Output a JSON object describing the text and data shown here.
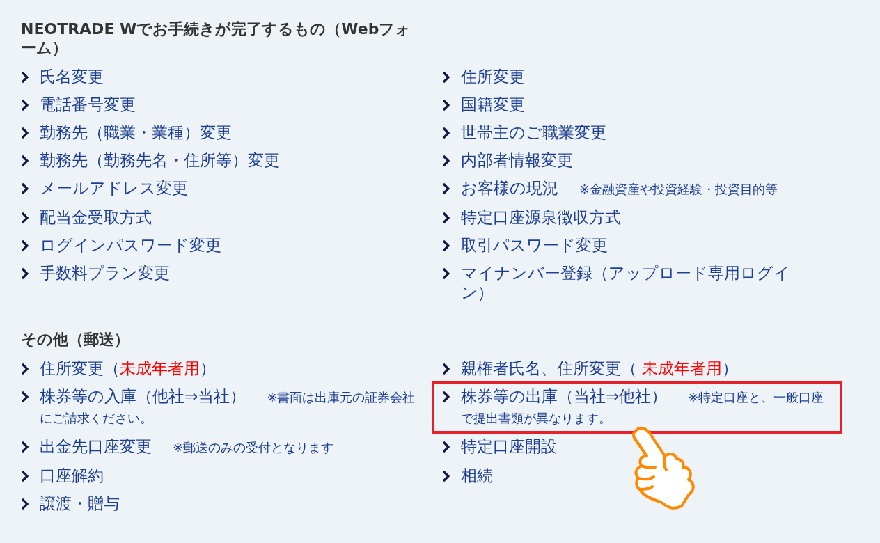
{
  "sections": [
    {
      "title": "NEOTRADE Wでお手続きが完了するもの（Webフォーム）",
      "columns": [
        [
          {
            "parts": [
              {
                "text": "氏名変更",
                "kind": "normal"
              }
            ],
            "highlighted": false
          },
          {
            "parts": [
              {
                "text": "電話番号変更",
                "kind": "normal"
              }
            ],
            "highlighted": false
          },
          {
            "parts": [
              {
                "text": "勤務先（職業・業種）変更",
                "kind": "normal"
              }
            ],
            "highlighted": false
          },
          {
            "parts": [
              {
                "text": "勤務先（勤務先名・住所等）変更",
                "kind": "normal"
              }
            ],
            "highlighted": false
          },
          {
            "parts": [
              {
                "text": "メールアドレス変更",
                "kind": "normal"
              }
            ],
            "highlighted": false
          },
          {
            "parts": [
              {
                "text": "配当金受取方式",
                "kind": "normal"
              }
            ],
            "highlighted": false
          },
          {
            "parts": [
              {
                "text": "ログインパスワード変更",
                "kind": "normal"
              }
            ],
            "highlighted": false
          },
          {
            "parts": [
              {
                "text": "手数料プラン変更",
                "kind": "normal"
              }
            ],
            "highlighted": false
          }
        ],
        [
          {
            "parts": [
              {
                "text": "住所変更",
                "kind": "normal"
              }
            ],
            "highlighted": false
          },
          {
            "parts": [
              {
                "text": "国籍変更",
                "kind": "normal"
              }
            ],
            "highlighted": false
          },
          {
            "parts": [
              {
                "text": "世帯主のご職業変更",
                "kind": "normal"
              }
            ],
            "highlighted": false
          },
          {
            "parts": [
              {
                "text": "内部者情報変更",
                "kind": "normal"
              }
            ],
            "highlighted": false
          },
          {
            "parts": [
              {
                "text": "お客様の現況",
                "kind": "normal"
              }
            ],
            "note": "※金融資産や投資経験・投資目的等",
            "highlighted": false
          },
          {
            "parts": [
              {
                "text": "特定口座源泉徴収方式",
                "kind": "normal"
              }
            ],
            "highlighted": false
          },
          {
            "parts": [
              {
                "text": "取引パスワード変更",
                "kind": "normal"
              }
            ],
            "highlighted": false
          },
          {
            "parts": [
              {
                "text": "マイナンバー登録（アップロード専用ログイン）",
                "kind": "normal"
              }
            ],
            "highlighted": false
          }
        ]
      ]
    },
    {
      "title": "その他（郵送）",
      "columns": [
        [
          {
            "parts": [
              {
                "text": "住所変更（",
                "kind": "normal"
              },
              {
                "text": "未成年者用",
                "kind": "warning"
              },
              {
                "text": "）",
                "kind": "normal"
              }
            ],
            "highlighted": false
          },
          {
            "parts": [
              {
                "text": "株券等の入庫（他社⇒当社）",
                "kind": "normal"
              }
            ],
            "note": "※書面は出庫元の証券会社にご請求ください。",
            "highlighted": false
          },
          {
            "parts": [
              {
                "text": "出金先口座変更",
                "kind": "normal"
              }
            ],
            "note": "※郵送のみの受付となります",
            "highlighted": false
          },
          {
            "parts": [
              {
                "text": "口座解約",
                "kind": "normal"
              }
            ],
            "highlighted": false
          },
          {
            "parts": [
              {
                "text": "譲渡・贈与",
                "kind": "normal"
              }
            ],
            "highlighted": false
          }
        ],
        [
          {
            "parts": [
              {
                "text": "親権者氏名、住所変更（ ",
                "kind": "normal"
              },
              {
                "text": "未成年者用",
                "kind": "warning"
              },
              {
                "text": "）",
                "kind": "normal"
              }
            ],
            "highlighted": false
          },
          {
            "parts": [
              {
                "text": "株券等の出庫（当社⇒他社）",
                "kind": "normal"
              }
            ],
            "note": "※特定口座と、一般口座で提出書類が異なります。",
            "highlighted": true
          },
          {
            "parts": [
              {
                "text": "特定口座開設",
                "kind": "normal"
              }
            ],
            "highlighted": false
          },
          {
            "parts": [
              {
                "text": "相続",
                "kind": "normal"
              }
            ],
            "highlighted": false
          }
        ]
      ]
    }
  ]
}
